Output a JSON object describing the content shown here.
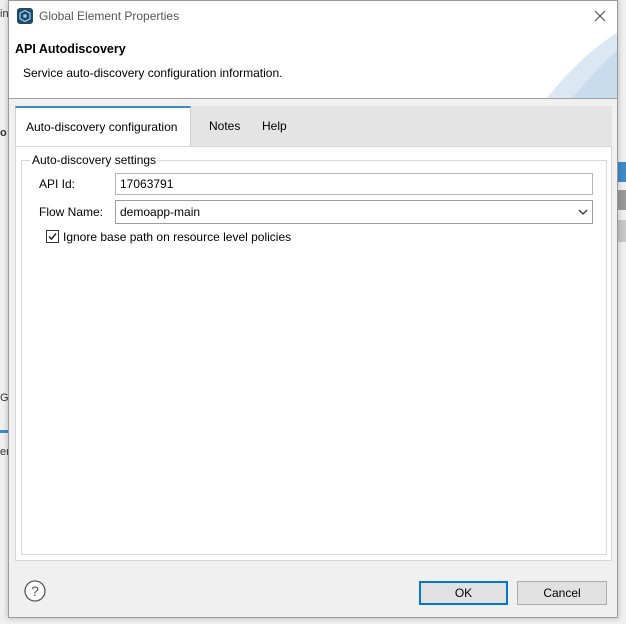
{
  "background": {
    "fragments": [
      "in",
      "o",
      "Gl",
      "er"
    ]
  },
  "dialog": {
    "window_title": "Global Element Properties",
    "header_title": "API Autodiscovery",
    "header_description": "Service auto-discovery configuration information.",
    "tabs": [
      {
        "label": "Auto-discovery configuration",
        "active": true
      },
      {
        "label": "Notes",
        "active": false
      },
      {
        "label": "Help",
        "active": false
      }
    ],
    "group_label": "Auto-discovery settings",
    "fields": {
      "api_id_label": "API Id:",
      "api_id_value": "17063791",
      "flow_name_label": "Flow Name:",
      "flow_name_value": "demoapp-main",
      "ignore_base_path_label": "Ignore base path on resource level policies",
      "ignore_base_path_checked": true
    },
    "buttons": {
      "ok": "OK",
      "cancel": "Cancel"
    },
    "icons": {
      "app": "app-icon",
      "close": "close-icon",
      "help": "help-icon",
      "dropdown": "chevron-down-icon",
      "check": "checkmark-icon"
    },
    "colors": {
      "active_tab_accent": "#3f8ac9",
      "default_button_border": "#0078d7"
    }
  }
}
